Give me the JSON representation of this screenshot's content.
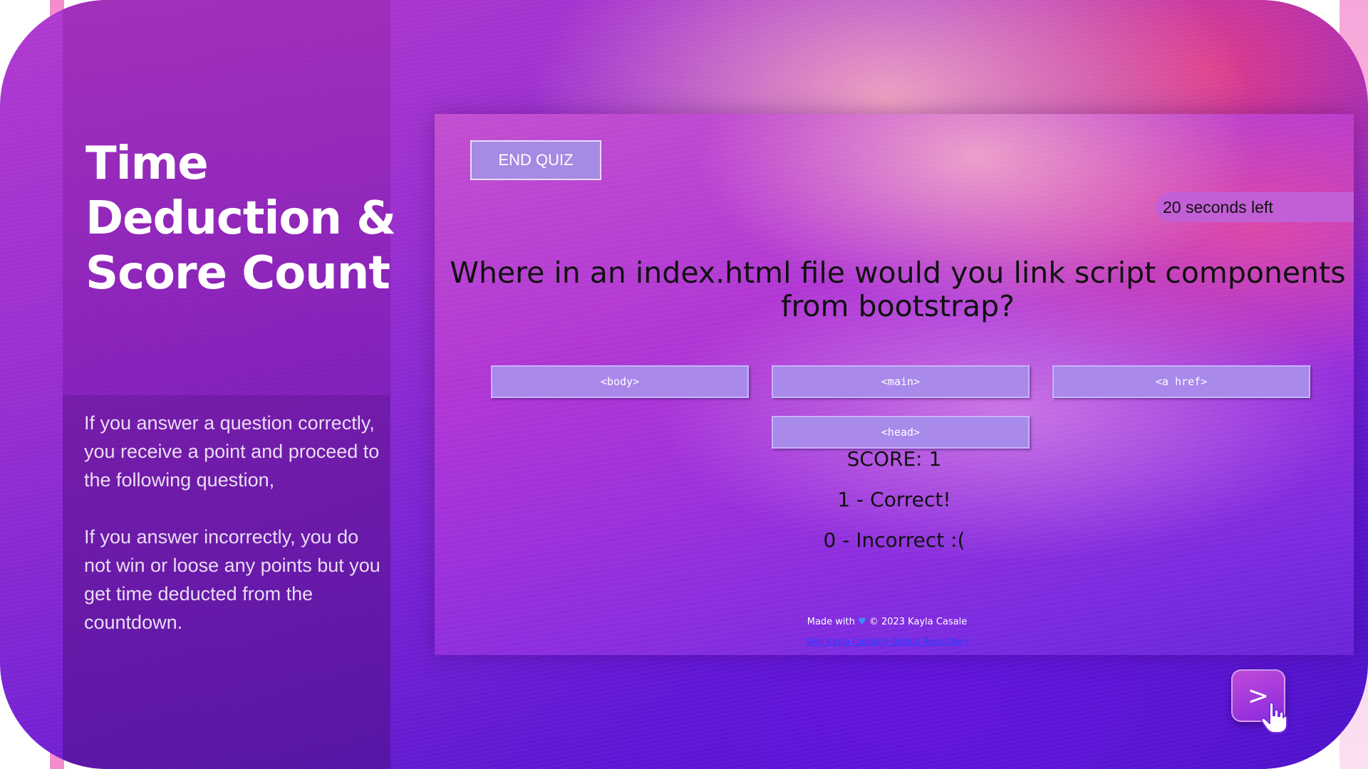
{
  "slide": {
    "title": "Time Deduction & Score Count",
    "paragraph_1": "If you answer a question correctly, you receive a point and proceed to the following question,",
    "paragraph_2": "If you answer incorrectly, you do not win or loose any points but you get time deducted from the countdown."
  },
  "quiz": {
    "end_button": "END QUIZ",
    "timer": "20 seconds left",
    "question": "Where in an index.html file would you link script components from bootstrap?",
    "answers": [
      "<body>",
      "<main>",
      "<a href>",
      "<head>"
    ],
    "score": "SCORE: 1",
    "correct": "1 - Correct!",
    "incorrect": "0 - Incorrect :(",
    "footer_made_before": "Made with",
    "footer_made_after": "© 2023 Kayla Casale",
    "footer_link": "Visit Kayla Casale's GitHub Repository"
  },
  "nav": {
    "next_label": ">"
  },
  "icons": {
    "heart": "blue-heart-icon",
    "pointer": "hand-pointer-icon"
  },
  "colors": {
    "button_fill": "#a989ea",
    "timer_fill": "#c25fd6",
    "link": "#2a3cff"
  }
}
